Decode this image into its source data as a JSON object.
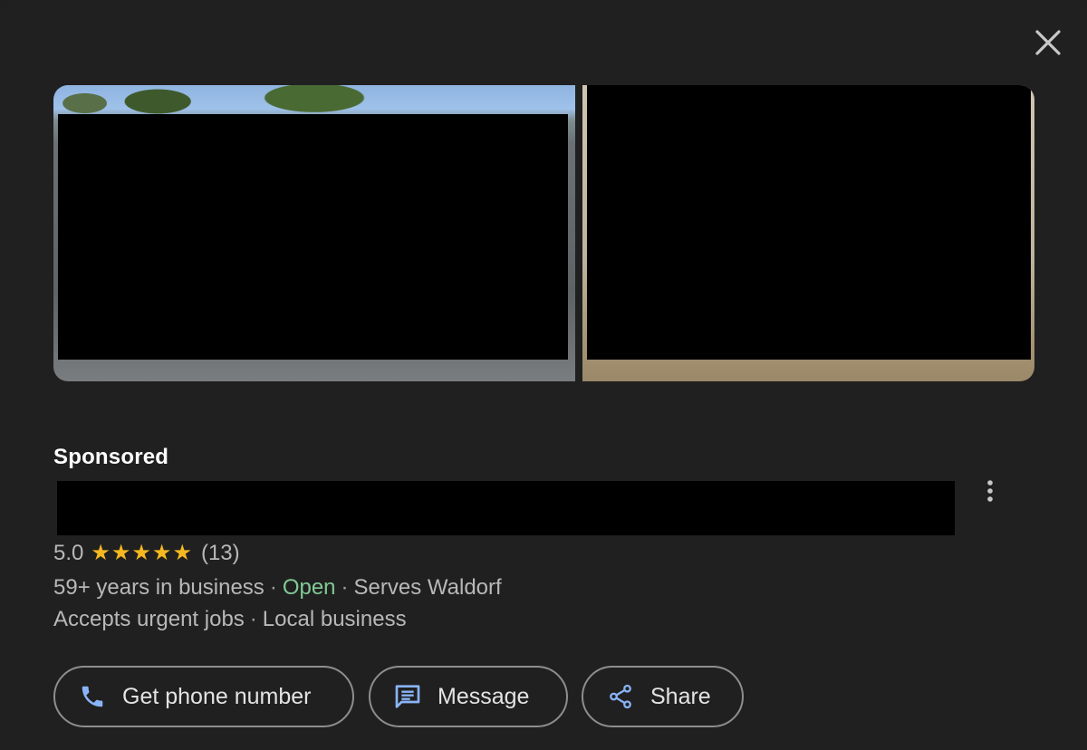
{
  "close": {
    "icon": "close-icon"
  },
  "photos": [
    {
      "alt": "",
      "redacted": true
    },
    {
      "alt": "",
      "redacted": true
    }
  ],
  "listing": {
    "sponsored_label": "Sponsored",
    "title_redacted": true,
    "rating_value": "5.0",
    "star_count": 5,
    "review_count": "(13)",
    "years": "59+ years in business",
    "status": "Open",
    "serves": "Serves Waldorf",
    "urgent": "Accepts urgent jobs",
    "local": "Local business",
    "separator": "·"
  },
  "actions": {
    "phone_label": "Get phone number",
    "message_label": "Message",
    "share_label": "Share"
  },
  "colors": {
    "background": "#202020",
    "star": "#f5b820",
    "open": "#81c995",
    "icon_blue": "#8ab4f8"
  }
}
